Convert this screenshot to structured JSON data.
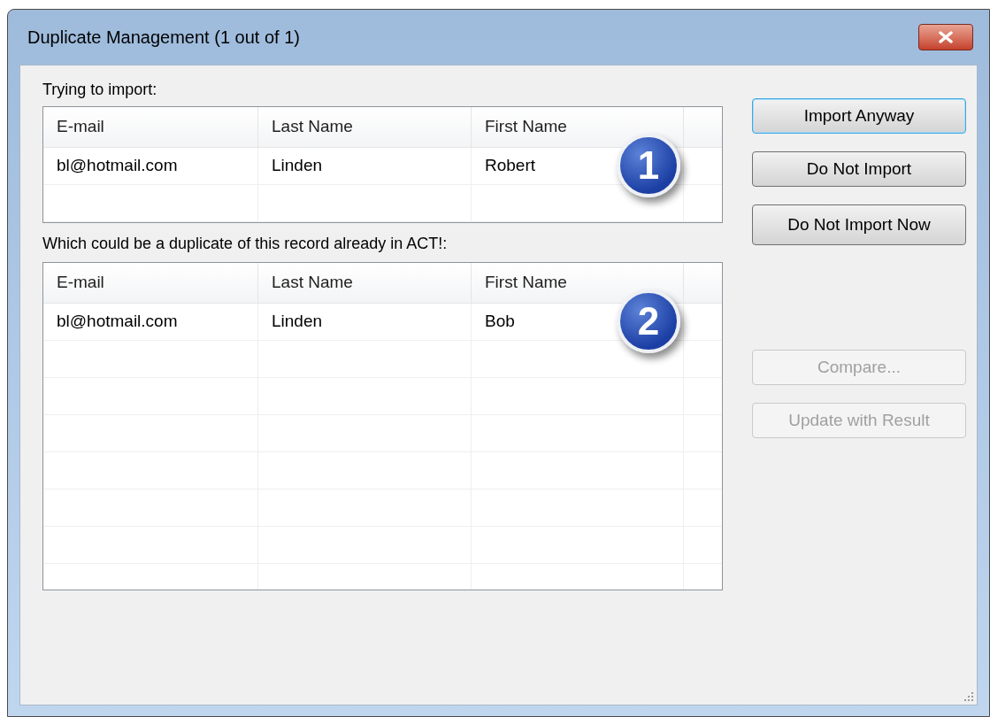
{
  "window": {
    "title": "Duplicate Management (1 out of 1)"
  },
  "import_section": {
    "label": "Trying to import:",
    "badge": "1",
    "columns": [
      "E-mail",
      "Last Name",
      "First Name"
    ],
    "rows": [
      [
        "bl@hotmail.com",
        "Linden",
        "Robert"
      ]
    ]
  },
  "duplicate_section": {
    "label": "Which could be a duplicate of this record already in ACT!:",
    "badge": "2",
    "columns": [
      "E-mail",
      "Last Name",
      "First Name"
    ],
    "rows": [
      [
        "bl@hotmail.com",
        "Linden",
        "Bob"
      ]
    ]
  },
  "buttons": [
    {
      "label": "Import Anyway",
      "focused": true,
      "disabled": false
    },
    {
      "label": "Do Not Import",
      "focused": false,
      "disabled": false
    },
    {
      "label": "Do Not Import Now",
      "focused": false,
      "disabled": false
    },
    {
      "label": "Compare...",
      "focused": false,
      "disabled": true
    },
    {
      "label": "Update with Result",
      "focused": false,
      "disabled": true
    }
  ]
}
